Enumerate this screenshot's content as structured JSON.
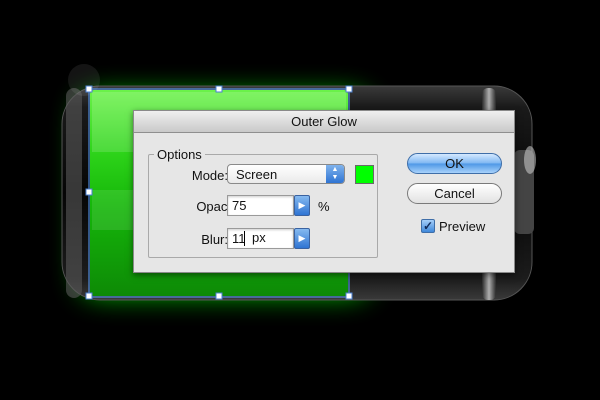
{
  "dialog": {
    "title": "Outer Glow",
    "options_group_label": "Options",
    "mode_label": "Mode:",
    "mode_value": "Screen",
    "glow_color": "#00ff00",
    "opacity_label": "Opacity:",
    "opacity_value": "75",
    "opacity_unit": "%",
    "blur_label": "Blur:",
    "blur_value": "11",
    "blur_unit": "px",
    "ok_label": "OK",
    "cancel_label": "Cancel",
    "preview_label": "Preview",
    "preview_checked": true
  },
  "colors": {
    "glow": "#00ff00",
    "accent": "#3f88da"
  }
}
